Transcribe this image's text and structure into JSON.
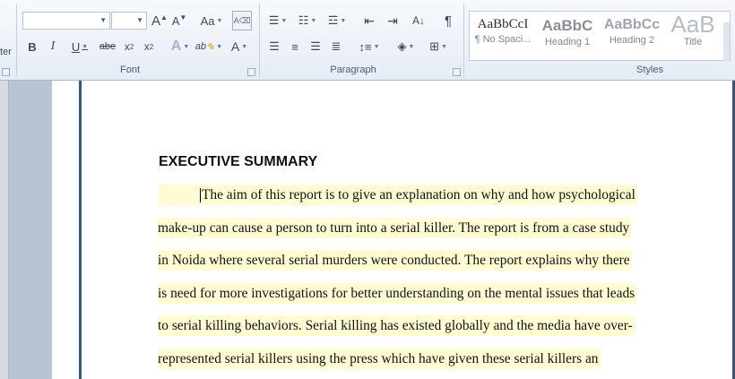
{
  "ribbon": {
    "clipboard_partial_label": "ter",
    "font_group": {
      "label": "Font",
      "font_name": "",
      "font_size": "",
      "grow_font": "A",
      "shrink_font": "A",
      "change_case": "Aa",
      "bold": "B",
      "italic": "I",
      "underline": "U",
      "strikethrough": "abe",
      "subscript": "x",
      "superscript": "x",
      "text_effects": "A",
      "highlight": "ab",
      "font_color": "A"
    },
    "paragraph_group": {
      "label": "Paragraph",
      "show_marks": "¶"
    },
    "styles_group": {
      "label": "Styles",
      "styles": [
        {
          "sample": "AaBbCcI",
          "name": "¶ No Spaci..."
        },
        {
          "sample": "AaBbC",
          "name": "Heading 1"
        },
        {
          "sample": "AaBbCc",
          "name": "Heading 2"
        },
        {
          "sample": "AaB",
          "name": "Title"
        }
      ]
    }
  },
  "document": {
    "heading": "EXECUTIVE SUMMARY",
    "lines": [
      "The aim of this report is to give an explanation on why and how psychological",
      "make-up can cause a person to turn into a serial killer. The report is from a case study",
      "in Noida where several serial murders were conducted. The report explains why there",
      "is need for more investigations for better understanding on the mental issues that leads",
      "to serial killing behaviors. Serial killing has existed globally and the media have over-",
      "represented serial killers using the press which have given these serial killers an"
    ]
  },
  "colors": {
    "highlight": "#fffbd2",
    "margin_line": "#3c5678",
    "ribbon_bg": "#e6ecf5"
  }
}
